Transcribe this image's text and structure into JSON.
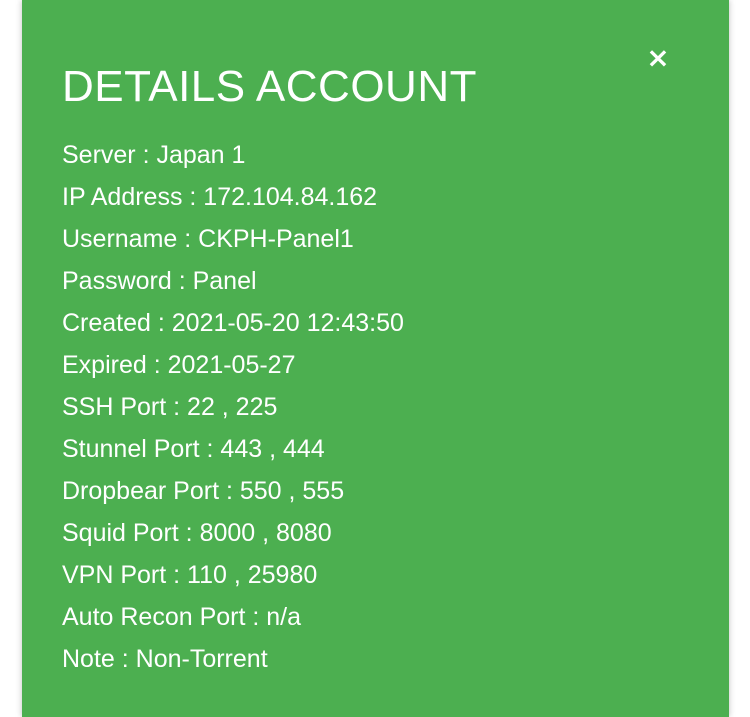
{
  "dialog": {
    "title": "DETAILS ACCOUNT",
    "close_label": "×",
    "background_color": "#4caf50",
    "text_color": "#ffffff"
  },
  "details": [
    {
      "text": "Server : Japan 1"
    },
    {
      "text": "IP Address : 172.104.84.162"
    },
    {
      "text": "Username : CKPH-Panel1"
    },
    {
      "text": "Password : Panel"
    },
    {
      "text": "Created : 2021-05-20 12:43:50"
    },
    {
      "text": "Expired : 2021-05-27"
    },
    {
      "text": "SSH Port : 22 , 225"
    },
    {
      "text": "Stunnel Port : 443 , 444"
    },
    {
      "text": "Dropbear Port : 550 , 555"
    },
    {
      "text": "Squid Port : 8000 , 8080"
    },
    {
      "text": "VPN Port : 110 , 25980"
    },
    {
      "text": "Auto Recon Port : n/a"
    },
    {
      "text": "Note : Non-Torrent"
    }
  ]
}
